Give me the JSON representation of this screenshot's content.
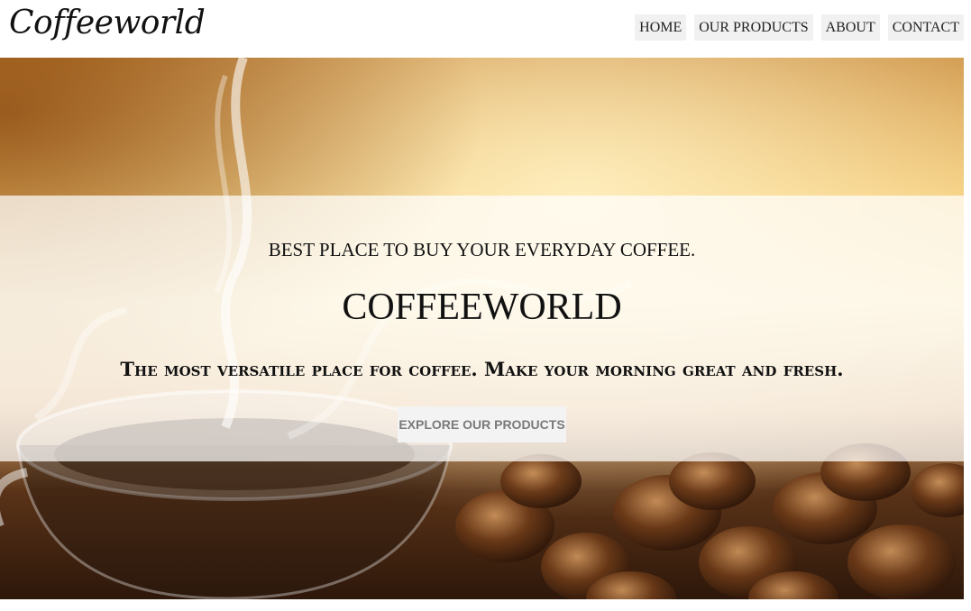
{
  "header": {
    "logo": "Coffeeworld",
    "nav": [
      {
        "label": "HOME"
      },
      {
        "label": "OUR PRODUCTS"
      },
      {
        "label": "ABOUT"
      },
      {
        "label": "CONTACT"
      }
    ]
  },
  "hero": {
    "tagline": "BEST PLACE TO BUY YOUR EVERYDAY COFFEE.",
    "title": "COFFEEWORLD",
    "subtitle": "The most versatile place for coffee. Make your morning great and fresh.",
    "cta_label": "EXPLORE OUR PRODUCTS",
    "image_description_icon": "coffee-cup-and-beans-image"
  },
  "colors": {
    "nav_bg": "#f1f1f1",
    "overlay": "rgba(255,255,255,0.72)",
    "button_text": "#7a7a7a"
  }
}
